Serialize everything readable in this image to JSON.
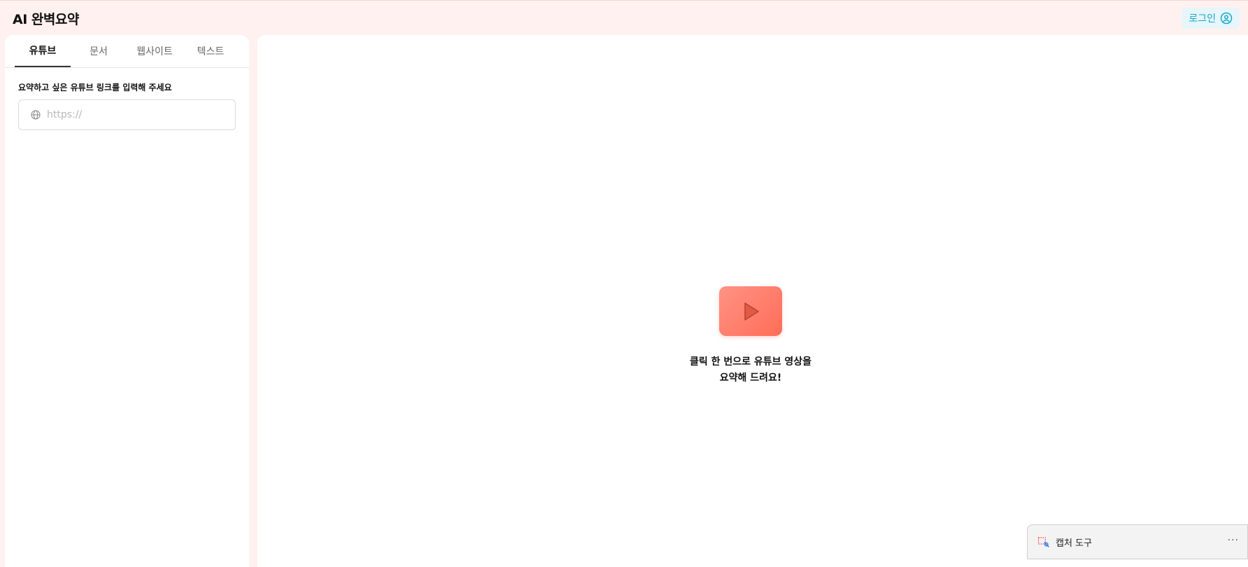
{
  "app": {
    "title": "AI 완벽요약"
  },
  "header": {
    "login_label": "로그인"
  },
  "tabs": [
    {
      "label": "유튜브",
      "active": true
    },
    {
      "label": "문서",
      "active": false
    },
    {
      "label": "웹사이트",
      "active": false
    },
    {
      "label": "텍스트",
      "active": false
    }
  ],
  "youtube_input": {
    "label": "요약하고 싶은 유튜브 링크를 입력해 주세요",
    "placeholder": "https://",
    "value": ""
  },
  "empty_state": {
    "line1": "클릭 한 번으로 유튜브 영상을",
    "line2": "요약해 드려요!"
  },
  "capture_tool": {
    "label": "캡처 도구",
    "more": "···"
  },
  "colors": {
    "background": "#fff1ef",
    "accent_login": "#1aa6cf",
    "play_gradient_start": "#ff9385",
    "play_gradient_end": "#ff6d57"
  },
  "icons": {
    "login": "user-circle-icon",
    "url": "globe-icon",
    "play": "play-icon",
    "capture": "snipping-tool-icon"
  }
}
